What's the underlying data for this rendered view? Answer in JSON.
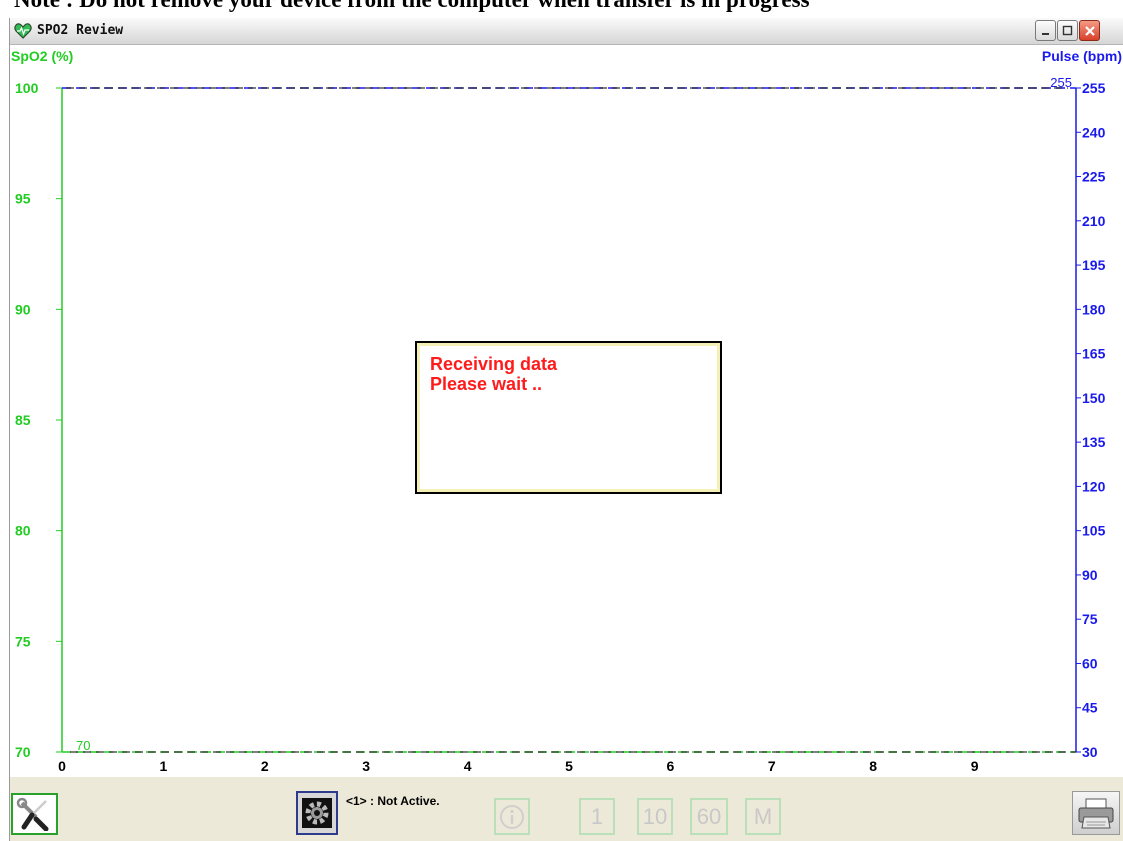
{
  "note": "Note : Do not remove your device from the computer when transfer is in progress",
  "window": {
    "title": "SPO2 Review",
    "title_icon": "heart-icon"
  },
  "chart_data": {
    "type": "line",
    "title": "",
    "ylabel": "SpO2 (%)",
    "y2label": "Pulse (bpm)",
    "xlim": [
      0,
      10
    ],
    "ylim": [
      70,
      100
    ],
    "y2lim": [
      30,
      255
    ],
    "x_ticks": [
      "0",
      "1",
      "2",
      "3",
      "4",
      "5",
      "6",
      "7",
      "8",
      "9"
    ],
    "y_ticks": [
      "100",
      "95",
      "90",
      "85",
      "80",
      "75",
      "70"
    ],
    "y2_ticks": [
      "255",
      "240",
      "225",
      "210",
      "195",
      "180",
      "165",
      "150",
      "135",
      "120",
      "105",
      "90",
      "75",
      "60",
      "45",
      "30"
    ],
    "series": [
      {
        "axis": "left",
        "color": "#22cc22",
        "x": [
          0,
          10
        ],
        "values": [
          70,
          70
        ]
      },
      {
        "axis": "right",
        "color": "#1a1aee",
        "x": [
          0,
          10
        ],
        "values": [
          255,
          255
        ]
      }
    ],
    "annotations": {
      "left_min_marker": "70",
      "right_max_marker": "255"
    },
    "grid": false,
    "colors": {
      "spo2": "#22cc22",
      "pulse": "#1a1aee"
    }
  },
  "dialog": {
    "line1": "Receiving data",
    "line2": "Please wait .."
  },
  "toolbar": {
    "status": "<1> : Not Active.",
    "settings_icon": "wrench-screwdriver-icon",
    "gear_icon": "gear-icon",
    "info_icon": "info-icon",
    "btn_1": "1",
    "btn_10": "10",
    "btn_60": "60",
    "btn_m": "M",
    "print_icon": "printer-icon"
  }
}
